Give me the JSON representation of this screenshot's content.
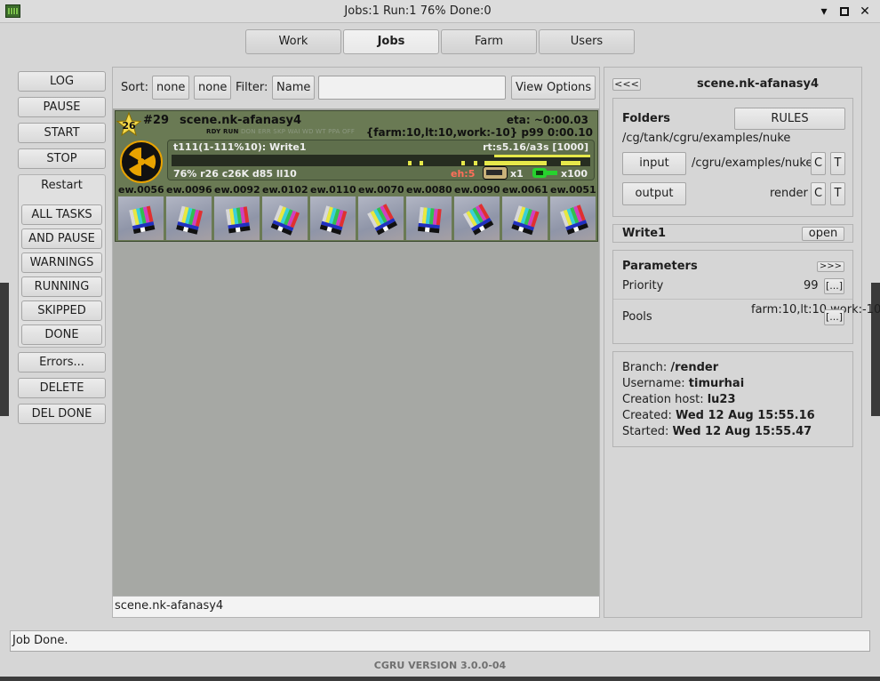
{
  "window": {
    "title": "Jobs:1 Run:1 76% Done:0",
    "minimize": "▾",
    "maximize": "▪",
    "close": "✕"
  },
  "tabs": [
    {
      "label": "Work",
      "active": false
    },
    {
      "label": "Jobs",
      "active": true
    },
    {
      "label": "Farm",
      "active": false
    },
    {
      "label": "Users",
      "active": false
    }
  ],
  "actions": {
    "log": "LOG",
    "pause": "PAUSE",
    "start": "START",
    "stop": "STOP",
    "restart_label": "Restart",
    "restart": [
      "ALL TASKS",
      "AND PAUSE",
      "WARNINGS",
      "RUNNING",
      "SKIPPED",
      "DONE"
    ],
    "errors": "Errors...",
    "delete": "DELETE",
    "del_done": "DEL DONE"
  },
  "toolbar": {
    "sort_label": "Sort:",
    "sort1": "none",
    "sort2": "none",
    "filter_label": "Filter:",
    "filter_field": "Name",
    "filter_value": "",
    "view_options": "View Options"
  },
  "job": {
    "priority_badge": "26",
    "number": "#29",
    "name": "scene.nk-afanasy4",
    "states_on": "RDY RUN",
    "states_off": "DON ERR SKP WAI WD WT PPA OFF",
    "eta": "eta: ~0:00.03",
    "capacity": "{farm:10,lt:10,work:-10} p99 0:00.10",
    "block": {
      "title": "t111(1-111%10): Write1",
      "render_time": "rt:s5.16/a3s [1000]",
      "progress_percent": 76,
      "stats": "76% r26 c26K d85 ll10",
      "errors_hosts": "eh:5",
      "tickets_x1": "x1",
      "tickets_x100": "x100"
    },
    "thumbnails": [
      "ew.0056",
      "ew.0096",
      "ew.0092",
      "ew.0102",
      "ew.0110",
      "ew.0070",
      "ew.0080",
      "ew.0090",
      "ew.0061",
      "ew.0051"
    ]
  },
  "bottom_field": "scene.nk-afanasy4",
  "right_panel": {
    "collapse_button": "<<<",
    "title": "scene.nk-afanasy4",
    "folders": {
      "label": "Folders",
      "rules_button": "RULES",
      "path": "/cg/tank/cgru/examples/nuke",
      "input_button": "input",
      "input_value": "/cgru/examples/nuke",
      "output_button": "output",
      "output_value": "render",
      "c": "C",
      "t": "T"
    },
    "block": {
      "name": "Write1",
      "open_button": "open"
    },
    "parameters": {
      "label": "Parameters",
      "expand_button": ">>>",
      "priority_label": "Priority",
      "priority_value": "99",
      "pools_label": "Pools",
      "pools_value": "farm:10,lt:10,work:-10",
      "edit_button": "[...]"
    },
    "info": {
      "branch_label": "Branch:",
      "branch": "/render",
      "username_label": "Username:",
      "username": "timurhai",
      "host_label": "Creation host:",
      "host": "lu23",
      "created_label": "Created:",
      "created": "Wed 12 Aug 15:55.16",
      "started_label": "Started:",
      "started": "Wed 12 Aug 15:55.47"
    }
  },
  "status": "Job Done.",
  "version": "CGRU VERSION 3.0.0-04",
  "colors": {
    "job_bg": "#6a7a54",
    "progress_done": "#e6e84a",
    "error": "#ff6f5a",
    "nuke_logo": "#e8a300"
  }
}
